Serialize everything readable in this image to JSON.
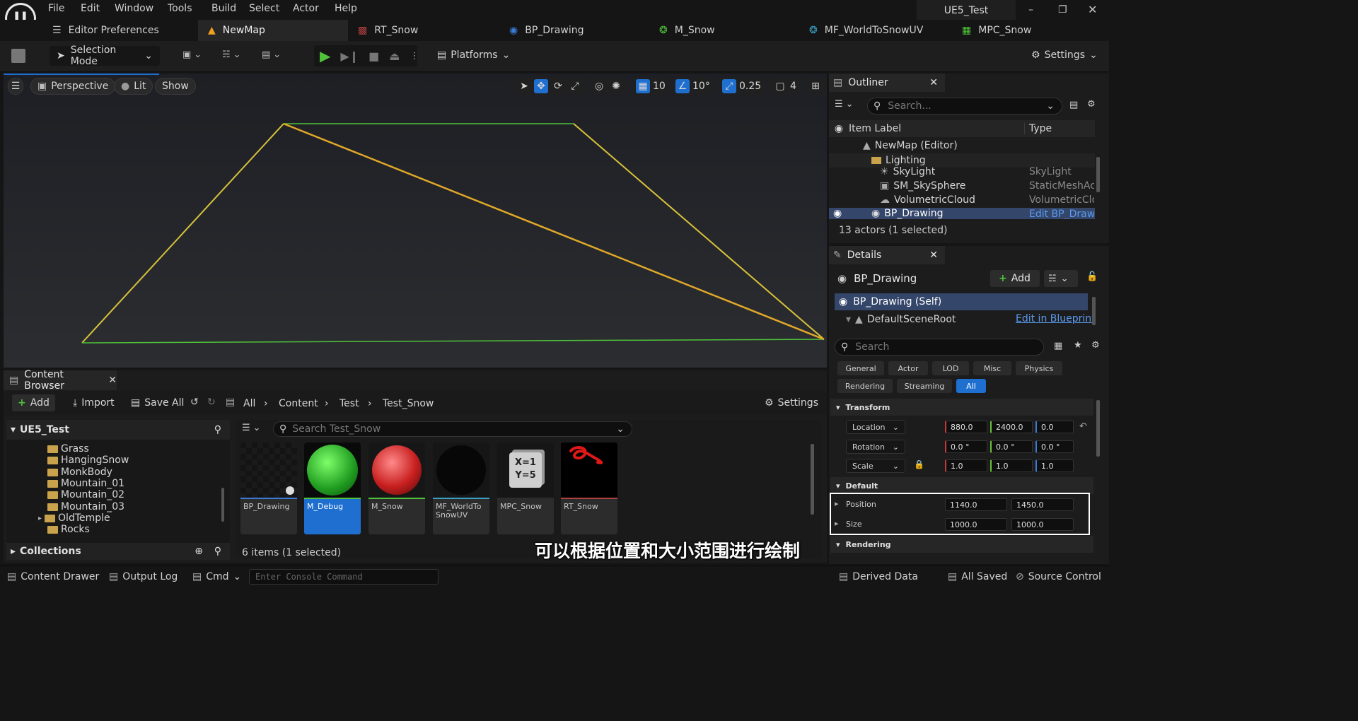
{
  "menu": [
    "File",
    "Edit",
    "Window",
    "Tools",
    "Build",
    "Select",
    "Actor",
    "Help"
  ],
  "window": {
    "title": "UE5_Test"
  },
  "tabs": [
    {
      "label": "Editor Preferences"
    },
    {
      "label": "NewMap"
    },
    {
      "label": "RT_Snow"
    },
    {
      "label": "BP_Drawing"
    },
    {
      "label": "M_Snow"
    },
    {
      "label": "MF_WorldToSnowUV"
    },
    {
      "label": "MPC_Snow"
    }
  ],
  "toolbar": {
    "selection_mode": "Selection Mode",
    "platforms": "Platforms",
    "settings": "Settings"
  },
  "viewport": {
    "perspective": "Perspective",
    "lit": "Lit",
    "show": "Show",
    "grid_snap": "10",
    "rotation_snap": "10°",
    "scale_snap": "0.25",
    "camera_speed": "4"
  },
  "content_browser": {
    "tab": "Content Browser",
    "add": "Add",
    "import": "Import",
    "save_all": "Save All",
    "breadcrumbs": [
      "All",
      "Content",
      "Test",
      "Test_Snow"
    ],
    "settings": "Settings",
    "root": "UE5_Test",
    "folders": [
      "Grass",
      "HangingSnow",
      "MonkBody",
      "Mountain_01",
      "Mountain_02",
      "Mountain_03",
      "OldTemple",
      "Rocks"
    ],
    "collections": "Collections",
    "search_placeholder": "Search Test_Snow",
    "assets": [
      {
        "line1": "BP_Drawing",
        "line2": ""
      },
      {
        "line1": "M_Debug",
        "line2": ""
      },
      {
        "line1": "M_Snow",
        "line2": ""
      },
      {
        "line1": "MF_WorldTo",
        "line2": "SnowUV"
      },
      {
        "line1": "MPC_Snow",
        "line2": ""
      },
      {
        "line1": "RT_Snow",
        "line2": ""
      }
    ],
    "status": "6 items (1 selected)"
  },
  "outliner": {
    "title": "Outliner",
    "search_placeholder": "Search...",
    "col_label": "Item Label",
    "col_type": "Type",
    "rows": [
      {
        "label": "NewMap (Editor)",
        "type": ""
      },
      {
        "label": "Lighting",
        "type": ""
      },
      {
        "label": "SkyLight",
        "type": "SkyLight"
      },
      {
        "label": "SM_SkySphere",
        "type": "StaticMeshAct"
      },
      {
        "label": "VolumetricCloud",
        "type": "VolumetricClou"
      },
      {
        "label": "BP_Drawing",
        "type": "Edit BP_Drawi"
      }
    ],
    "status": "13 actors (1 selected)"
  },
  "details": {
    "title": "Details",
    "actor": "BP_Drawing",
    "add": "Add",
    "self": "BP_Drawing (Self)",
    "root": "DefaultSceneRoot",
    "edit_bp": "Edit in Blueprint",
    "search_placeholder": "Search",
    "categories": [
      "General",
      "Actor",
      "LOD",
      "Misc",
      "Physics",
      "Rendering",
      "Streaming",
      "All"
    ],
    "transform": {
      "title": "Transform",
      "location_label": "Location",
      "rotation_label": "Rotation",
      "scale_label": "Scale",
      "location": [
        "880.0",
        "2400.0",
        "0.0"
      ],
      "rotation": [
        "0.0 °",
        "0.0 °",
        "0.0 °"
      ],
      "scale": [
        "1.0",
        "1.0",
        "1.0"
      ]
    },
    "default": {
      "title": "Default",
      "position_label": "Position",
      "size_label": "Size",
      "position": [
        "1140.0",
        "1450.0"
      ],
      "size": [
        "1000.0",
        "1000.0"
      ]
    },
    "rendering_title": "Rendering"
  },
  "statusbar": {
    "content_drawer": "Content Drawer",
    "output_log": "Output Log",
    "cmd": "Cmd",
    "console_placeholder": "Enter Console Command",
    "derived_data": "Derived Data",
    "all_saved": "All Saved",
    "source_control": "Source Control"
  },
  "subtitle": "可以根据位置和大小范围进行绘制",
  "colors": {
    "accent": "#1f6fd1",
    "highlight_box": "#ffffff",
    "draw_yellow": "#d8c23a",
    "draw_green": "#4fc23a"
  }
}
